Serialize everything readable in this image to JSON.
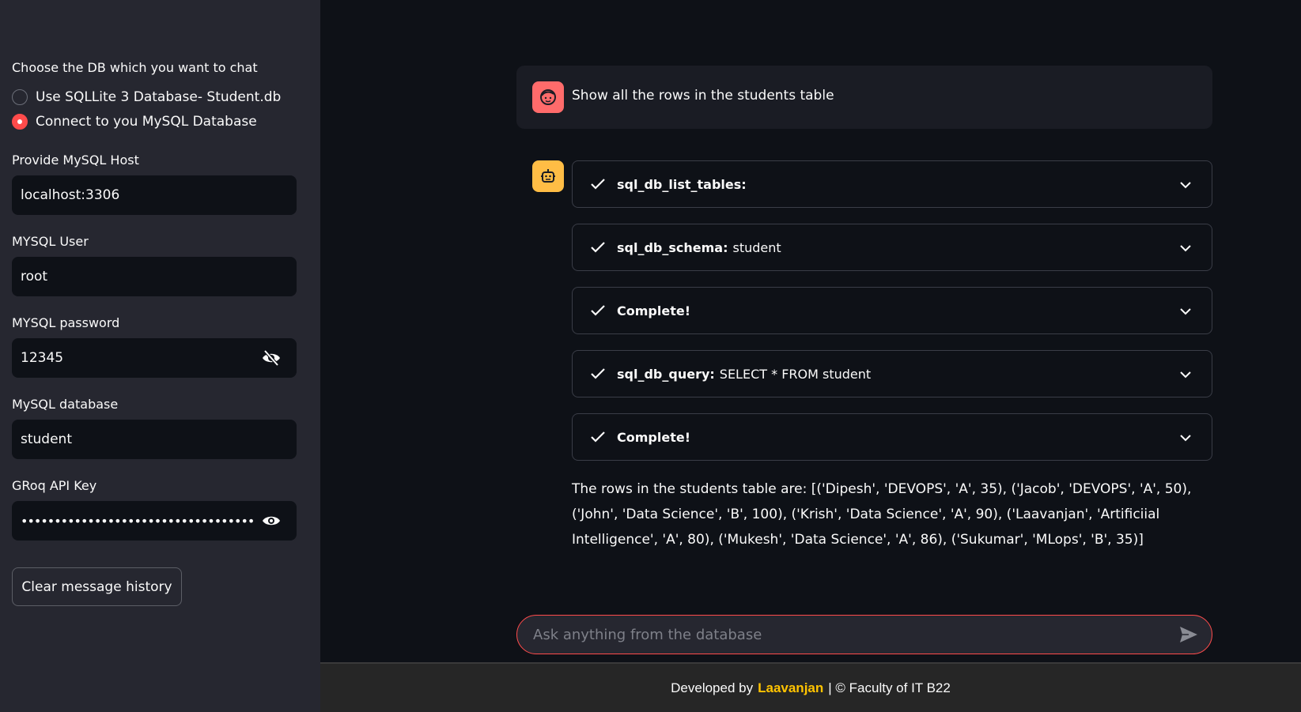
{
  "sidebar": {
    "db_choice_label": "Choose the DB which you want to chat",
    "options": [
      {
        "label": "Use SQLLite 3 Database- Student.db",
        "selected": false
      },
      {
        "label": "Connect to you MySQL Database",
        "selected": true
      }
    ],
    "host": {
      "label": "Provide MySQL Host",
      "value": "localhost:3306"
    },
    "user": {
      "label": "MYSQL User",
      "value": "root"
    },
    "password": {
      "label": "MYSQL password",
      "value": "12345"
    },
    "database": {
      "label": "MySQL database",
      "value": "student"
    },
    "api_key": {
      "label": "GRoq API Key",
      "value": "••••••••••••••••••••••••••••••••••••••••••••••••••••••"
    },
    "clear_button": "Clear message history"
  },
  "chat": {
    "user_message": "Show all the rows in the students table",
    "steps": [
      {
        "title": "sql_db_list_tables:",
        "detail": ""
      },
      {
        "title": "sql_db_schema:",
        "detail": "student"
      },
      {
        "title": "Complete!",
        "detail": ""
      },
      {
        "title": "sql_db_query:",
        "detail": "SELECT * FROM student"
      },
      {
        "title": "Complete!",
        "detail": ""
      }
    ],
    "answer": "The rows in the students table are: [('Dipesh', 'DEVOPS', 'A', 35), ('Jacob', 'DEVOPS', 'A', 50), ('John', 'Data Science', 'B', 100), ('Krish', 'Data Science', 'A', 90), ('Laavanjan', 'Artificiial Intelligence', 'A', 80), ('Mukesh', 'Data Science', 'A', 86), ('Sukumar', 'MLops', 'B', 35)]",
    "input_placeholder": "Ask anything from the database"
  },
  "footer": {
    "prefix": "Developed by",
    "author": "Laavanjan",
    "suffix": "| © Faculty of IT B22"
  },
  "colors": {
    "accent": "#ff4b4b",
    "author": "#ffc300",
    "user_avatar": "#ff6b6b",
    "bot_avatar": "#ffbd45"
  }
}
